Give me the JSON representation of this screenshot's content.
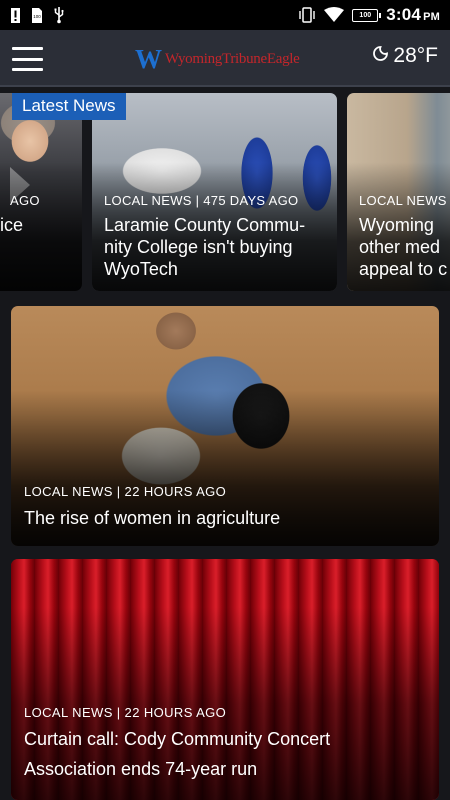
{
  "status_bar": {
    "left_icons": [
      "alert-icon",
      "sd-card-icon",
      "usb-icon"
    ],
    "battery_level": "100",
    "time": "3:04",
    "ampm": "PM"
  },
  "header": {
    "logo_mark": "W",
    "logo_text": "WyomingTribuneEagle",
    "weather_temp": "28°F",
    "weather_icon": "night-moon-icon"
  },
  "carousel": {
    "badge": "Latest News",
    "items": [
      {
        "meta": "AGO",
        "title_lines": [
          "ice",
          ""
        ]
      },
      {
        "meta": "LOCAL NEWS | 475 DAYS AGO",
        "title_lines": [
          "Laramie County Commu-",
          "nity College isn't buying",
          "WyoTech"
        ]
      },
      {
        "meta": "LOCAL NEWS",
        "title_lines": [
          "Wyoming",
          "other med",
          "appeal to c"
        ]
      }
    ]
  },
  "features": [
    {
      "meta": "LOCAL NEWS | 22 HOURS AGO",
      "title": "The rise of women in agriculture"
    },
    {
      "meta": "LOCAL NEWS | 22 HOURS AGO",
      "title_lines": [
        "Curtain call: Cody Community Concert",
        "Association ends 74-year run"
      ]
    }
  ],
  "colors": {
    "appbar": "#2b2e37",
    "badge": "#1c5fb7",
    "logo_blue": "#1d6fd0",
    "logo_red": "#c3262b"
  }
}
